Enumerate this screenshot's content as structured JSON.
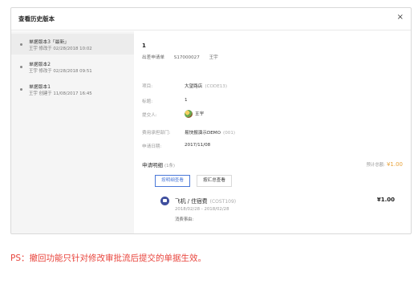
{
  "modal": {
    "title": "查看历史版本",
    "close_glyph": "×"
  },
  "sidebar": {
    "items": [
      {
        "title": "单据版本3「最新」",
        "sub": "王宇 修改于 02/28/2018 10:02"
      },
      {
        "title": "单据版本2",
        "sub": "王宇 修改于 02/28/2018 09:51"
      },
      {
        "title": "单据版本1",
        "sub": "王宇 创建于 11/08/2017 16:45"
      }
    ]
  },
  "doc": {
    "no": "1",
    "meta_label": "出差申请单",
    "meta_id": "S17000027",
    "meta_user": "王宇"
  },
  "fields": {
    "project_label": "项目:",
    "project_value": "大望路店",
    "project_code": "(CODE13)",
    "title_label": "标题:",
    "title_value": "1",
    "submitter_label": "提交人:",
    "submitter_value": "王宇",
    "dept_label": "费用承担部门:",
    "dept_value": "易快报演示DEMO",
    "dept_code": "(001)",
    "date_label": "申请日期:",
    "date_value": "2017/11/08"
  },
  "details": {
    "title": "申请明细",
    "count": "(1条)",
    "total_label": "预计总额:",
    "total_amount": "¥1.00",
    "tab_by_detail": "按明细查看",
    "tab_by_summary": "按汇总查看"
  },
  "expense": {
    "icon": "transport-icon",
    "title": "飞机 / 住宿费",
    "code": "(COST109)",
    "date_range": "2018/02/28 - 2018/02/28",
    "reason": "消费事由:",
    "amount": "¥1.00"
  },
  "note": "PS：撤回功能只针对修改审批流后提交的单据生效。",
  "colors": {
    "accent": "#4a78d8",
    "amount": "#e8a33c",
    "note": "#e8443c"
  }
}
